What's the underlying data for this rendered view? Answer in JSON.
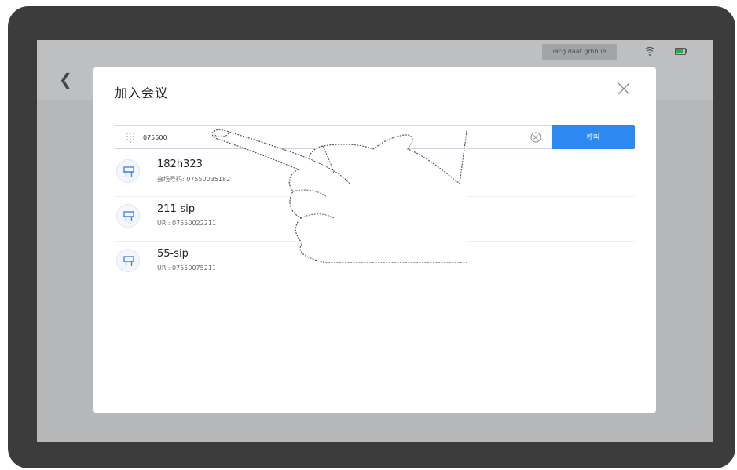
{
  "status_bar": {
    "label": "iacg daat grhh ie"
  },
  "dialog": {
    "title": "加入会议"
  },
  "search": {
    "value": "075500",
    "placeholder": ""
  },
  "call_button": {
    "label": "呼叫"
  },
  "results": [
    {
      "name": "182h323",
      "detail": "会场号码: 07550035182",
      "icon": "meeting-room-icon"
    },
    {
      "name": "211-sip",
      "detail": "URI: 07550022211",
      "icon": "meeting-room-icon"
    },
    {
      "name": "55-sip",
      "detail": "URI: 07550075211",
      "icon": "meeting-room-icon"
    }
  ],
  "colors": {
    "accent": "#2d89f1",
    "bezel": "#3c3c3c",
    "battery": "#2ea74a"
  }
}
